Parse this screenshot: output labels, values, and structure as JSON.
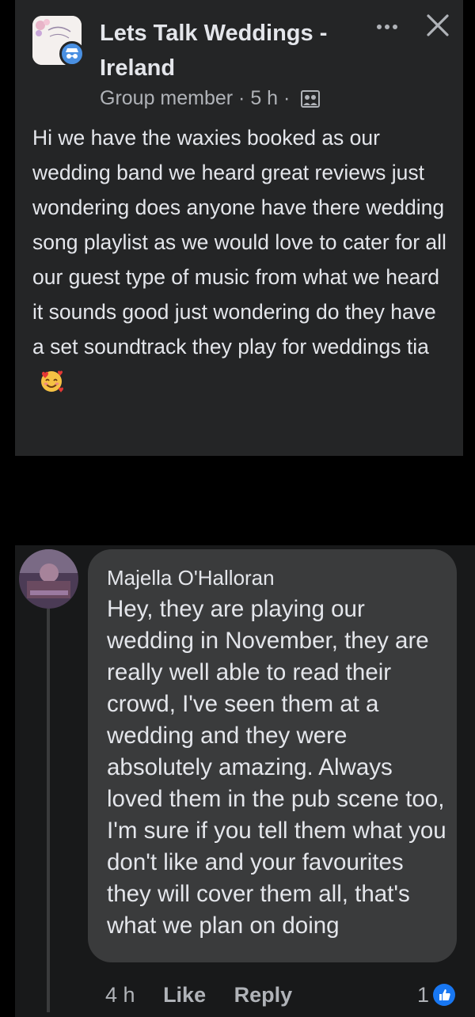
{
  "post": {
    "title": "Lets Talk Weddings - Ireland",
    "meta": "Group member · 5 h ·",
    "body": "Hi we have the waxies booked as our wedding band we heard great reviews just wondering does anyone have there wedding song playlist as we would love to cater for all our guest type of music from what we heard it sounds good just wondering do they have a set soundtrack they play for weddings tia",
    "emoji_icon": "smiling-face-with-hearts-icon",
    "group_logo_text": "Let's Talk Weddings"
  },
  "comment": {
    "author": "Majella O'Halloran",
    "text": "Hey, they are playing our wedding in November, they are really well able to read their crowd, I've seen them at a  wedding and they were absolutely amazing. Always loved them in the pub scene too, I'm sure if you tell them what you don't like and your favourites they will cover them all, that's what we plan on doing",
    "time": "4 h",
    "like_label": "Like",
    "reply_label": "Reply",
    "reaction_count": "1"
  },
  "colors": {
    "background": "#000000",
    "card": "#242526",
    "bubble": "#3a3b3c",
    "text_primary": "#e4e6eb",
    "text_secondary": "#b0b3b8",
    "like_blue": "#1877f2"
  }
}
